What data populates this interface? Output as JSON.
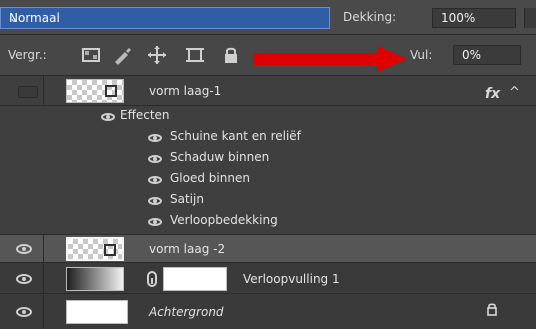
{
  "row1": {
    "blend_mode": "Normaal",
    "opacity_label": "Dekking:",
    "opacity_value": "100%"
  },
  "row2": {
    "lock_label": "Vergr.:",
    "fill_label": "Vul:",
    "fill_value": "0%"
  },
  "annotation": {
    "arrow_color": "#e00000"
  },
  "layers": [
    {
      "name": "vorm laag-1",
      "has_fx": true,
      "effects_title": "Effecten",
      "effects": [
        "Schuine kant en reliëf",
        "Schaduw binnen",
        "Gloed binnen",
        "Satijn",
        "Verloopbedekking"
      ]
    },
    {
      "name": "vorm laag -2"
    },
    {
      "name": "Verloopvulling 1"
    },
    {
      "name": "Achtergrond"
    }
  ],
  "icons": {
    "fx": "fx",
    "chevron_up": "^",
    "chevron_down": "⌄"
  },
  "colors": {
    "accent_blue": "#2f5ea6",
    "panel_dark": "#3a3a3a",
    "selection": "#565656"
  }
}
